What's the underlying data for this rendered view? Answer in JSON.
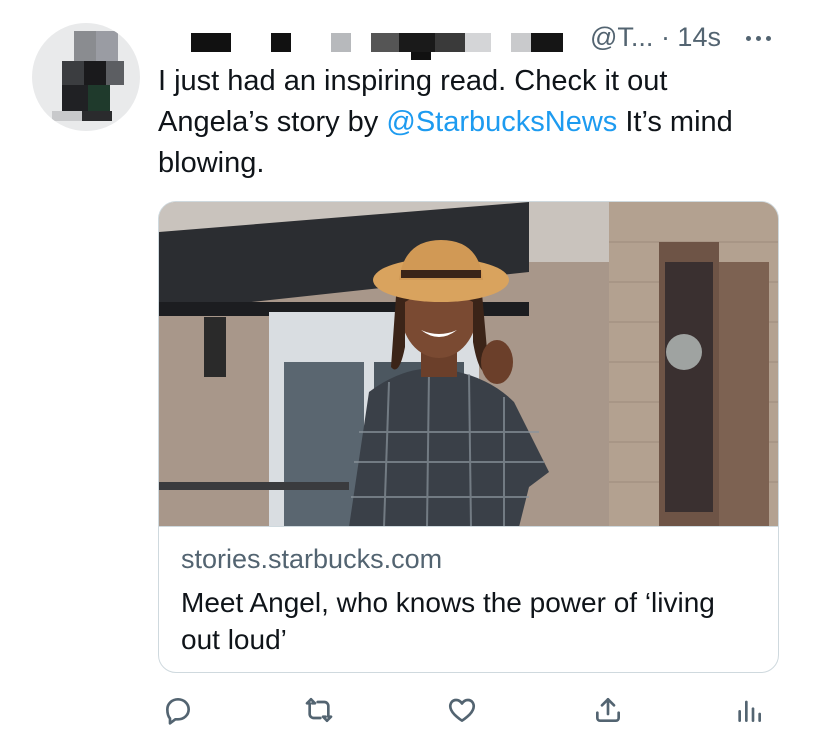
{
  "author": {
    "handle": "@T...",
    "time": "· 14s"
  },
  "tweet": {
    "text_before": "I just had an inspiring read. Check  it out Angela’s story by ",
    "mention": "@StarbucksNews",
    "text_after": " It’s mind blowing."
  },
  "card": {
    "domain": "stories.starbucks.com",
    "title": "Meet Angel, who knows the power of ‘living out loud’"
  },
  "icons": {
    "more": "more-icon",
    "reply": "reply-icon",
    "retweet": "retweet-icon",
    "like": "like-icon",
    "share": "share-icon",
    "analytics": "analytics-icon"
  },
  "colors": {
    "accent": "#1d9bf0",
    "secondary_text": "#536471",
    "border": "#cfd9de"
  }
}
